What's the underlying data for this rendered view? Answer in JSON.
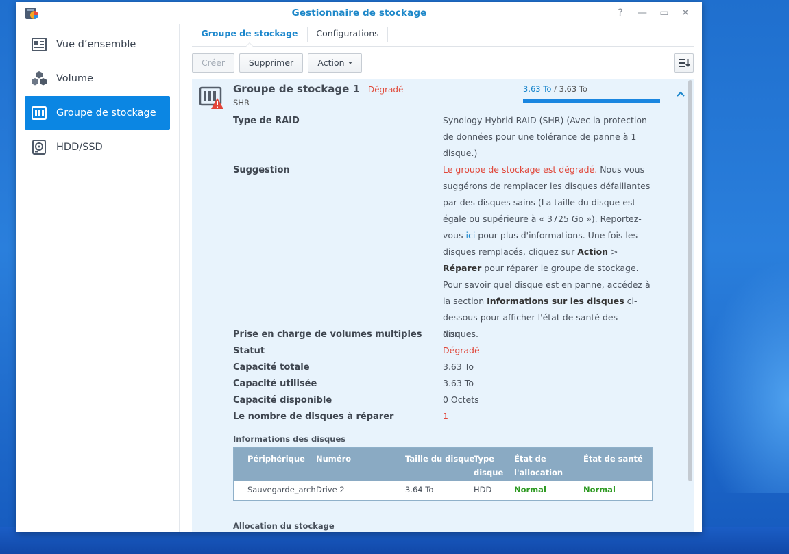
{
  "window": {
    "title": "Gestionnaire de stockage",
    "controls": [
      "?",
      "—",
      "▭",
      "✕"
    ]
  },
  "sidebar": {
    "items": [
      {
        "label": "Vue d’ensemble",
        "icon": "overview-icon"
      },
      {
        "label": "Volume",
        "icon": "volume-cubes-icon"
      },
      {
        "label": "Groupe de stockage",
        "icon": "storage-pool-icon",
        "active": true
      },
      {
        "label": "HDD/SSD",
        "icon": "hdd-icon"
      }
    ]
  },
  "tabs": [
    {
      "label": "Groupe de stockage",
      "active": true
    },
    {
      "label": "Configurations"
    }
  ],
  "toolbar": {
    "create": "Créer",
    "delete": "Supprimer",
    "action": "Action"
  },
  "pool": {
    "name": "Groupe de stockage 1",
    "state": " - Dégradé",
    "type": "SHR",
    "capacity_used": "3.63 To",
    "capacity_sep": " / ",
    "capacity_total": "3.63 To",
    "usage_fraction": 1.0
  },
  "details": {
    "raid_label": "Type de RAID",
    "raid_value": "Synology Hybrid RAID (SHR) (Avec la protection de données pour une tolérance de panne à 1 disque.)",
    "suggestion_label": "Suggestion",
    "suggestion": {
      "red": "Le groupe de stockage est dégradé.",
      "t1": " Nous vous suggérons de remplacer les disques défaillantes par des disques sains (La taille du disque est égale ou supérieure à « 3725 Go »). Reportez-vous ",
      "link": "ici",
      "t2": " pour plus d'informations. Une fois les disques remplacés, cliquez sur ",
      "b1": "Action",
      "t3": " > ",
      "b2": "Réparer",
      "t4": " pour réparer le groupe de stockage. Pour savoir quel disque est en panne, accédez à la section ",
      "b3": "Informations sur les disques",
      "t5": " ci-dessous pour afficher l'état de santé des disques."
    },
    "multi_label": "Prise en charge de volumes multiples",
    "multi_value": "Non",
    "status_label": "Statut",
    "status_value": "Dégradé",
    "total_label": "Capacité totale",
    "total_value": "3.63 To",
    "used_label": "Capacité utilisée",
    "used_value": "3.63 To",
    "free_label": "Capacité disponible",
    "free_value": "0 Octets",
    "repair_label": "Le nombre de disques à réparer",
    "repair_value": "1"
  },
  "disks": {
    "title": "Informations des disques",
    "headers": [
      "Périphérique",
      "Numéro",
      "Taille du disque",
      "Type disque",
      "État de l'allocation",
      "État de santé"
    ],
    "rows": [
      {
        "device": "Sauvegarde_arch",
        "number": "Drive 2",
        "size": "3.64 To",
        "type": "HDD",
        "allocation": "Normal",
        "health": "Normal"
      }
    ]
  },
  "allocation_title": "Allocation du stockage",
  "colors": {
    "accent": "#0b86e3",
    "title": "#1e88c9",
    "danger": "#e14b3b",
    "ok": "#2e9a22",
    "panel": "#e8f3fc",
    "table_header": "#8aaac3"
  }
}
